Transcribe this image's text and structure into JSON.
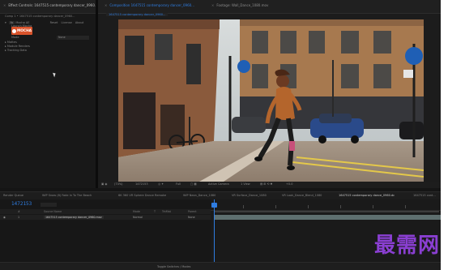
{
  "left_panel": {
    "tab_title": "Effect Controls: 1647515 contemporary dancer_0960...",
    "path": "Comp 1 • 1647515 contemporary dancer_0960...",
    "effect_name": "Mocha AE",
    "buttons": [
      "Reset",
      "License",
      "About"
    ],
    "launch_label": "Launch Mocha",
    "mocha_label": "MOCHA",
    "mode_label": "Mode",
    "mode_value": "None",
    "sections": [
      "Mattes",
      "Module Renders",
      "Tracking Data"
    ]
  },
  "viewer": {
    "tabs": [
      {
        "label": "Composition 1647515 contemporary dancer_0960...",
        "active": true
      },
      {
        "label": "Footage: Wall_Dance_1080.mov",
        "active": false
      }
    ],
    "comp_label": "1647515 contemporary dancer_0960...",
    "toolbar": {
      "zoom": "(74%)",
      "timecode": "1472153",
      "resolution": "Full",
      "camera": "Active Camera",
      "view": "1 View",
      "exposure": "+0.0"
    }
  },
  "timeline": {
    "tabs": [
      {
        "label": "Render Queue",
        "active": false
      },
      {
        "label": "WIP Snow (6) Fade In To The Beach",
        "active": false
      },
      {
        "label": "6K 360 VR Sphere Dance Remake",
        "active": false
      },
      {
        "label": "WIP Neon_Dance_1080",
        "active": false
      },
      {
        "label": "VR Surface_Dance_1080",
        "active": false
      },
      {
        "label": "VR Look_Dance_Blend_1080",
        "active": false
      },
      {
        "label": "1647515 contemporary dance_0960.dc",
        "active": true
      },
      {
        "label": "1647515 cont...",
        "active": false
      }
    ],
    "timecode": "1472153",
    "columns": [
      "#",
      "Source Name",
      "Mode",
      "T",
      "TrkMat",
      "Parent"
    ],
    "layer": {
      "index": "1",
      "name": "1647515 contemporary dancer_0960.mov",
      "mode": "Normal",
      "parent": "None"
    },
    "status": "Toggle Switches / Modes"
  },
  "watermark": "最需网",
  "colors": {
    "accent": "#2f7de1",
    "mocha": "#d9532b",
    "watermark": "#8a3fd2"
  }
}
